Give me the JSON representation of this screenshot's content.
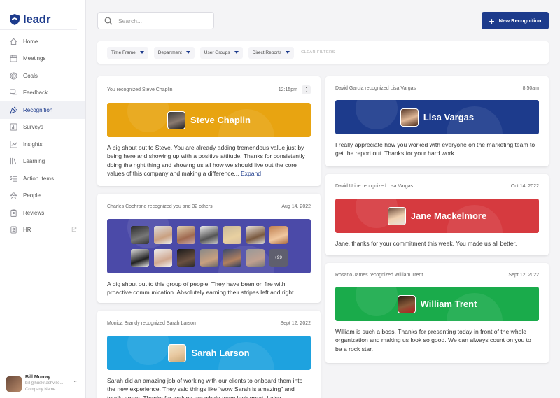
{
  "app": {
    "name": "leadr"
  },
  "sidebar": {
    "items": [
      {
        "label": "Home",
        "icon": "home-icon",
        "active": false
      },
      {
        "label": "Meetings",
        "icon": "meetings-icon",
        "active": false
      },
      {
        "label": "Goals",
        "icon": "target-icon",
        "active": false
      },
      {
        "label": "Feedback",
        "icon": "chat-bubbles-icon",
        "active": false
      },
      {
        "label": "Recognition",
        "icon": "party-popper-icon",
        "active": true
      },
      {
        "label": "Surveys",
        "icon": "bar-chart-icon",
        "active": false
      },
      {
        "label": "Insights",
        "icon": "trend-line-icon",
        "active": false
      },
      {
        "label": "Learning",
        "icon": "books-icon",
        "active": false
      },
      {
        "label": "Action Items",
        "icon": "checklist-icon",
        "active": false
      },
      {
        "label": "People",
        "icon": "people-icon",
        "active": false
      },
      {
        "label": "Reviews",
        "icon": "clipboard-icon",
        "active": false
      },
      {
        "label": "HR",
        "icon": "id-badge-icon",
        "active": false,
        "external": true
      }
    ],
    "user": {
      "name": "Bill Murray",
      "email": "bill@husknashville....",
      "company": "Company Name"
    }
  },
  "search": {
    "placeholder": "Search..."
  },
  "new_button": {
    "label": "New Recognition"
  },
  "filters": {
    "items": [
      "Time Frame",
      "Department",
      "User Groups",
      "Direct Reports"
    ],
    "clear": "CLEAR FILTERS"
  },
  "cards": [
    {
      "header": "You recognized Steve Chaplin",
      "time": "12:15pm",
      "recipient": "Steve Chaplin",
      "banner_color": "#e8a411",
      "text": "A big shout out to Steve. You are already adding tremendous value just by being here and showing up with a positive attitude. Thanks for consistently doing the right thing and showing us all how we should live out the core values of this company and making a difference...",
      "expand": "Expand"
    },
    {
      "header": "Charles Cochrane recognized you and 32 others",
      "time": "Aug 14, 2022",
      "banner_color": "#4b4aa8",
      "more_count": "+99",
      "text": "A big shout out to this group of people. They have been on fire with proactive communication. Absolutely earning their stripes left and right."
    },
    {
      "header": "Monica Brandy recognized Sarah Larson",
      "time": "Sept 12, 2022",
      "recipient": "Sarah Larson",
      "banner_color": "#1ea2df",
      "text": "Sarah did an amazing job of working with our clients to onboard them into the new experience. They said things like “wow Sarah is amazing” and I totally agree. Thanks for making our whole team look great. I also"
    },
    {
      "header": "David Garcia recognized Lisa Vargas",
      "time": "8:50am",
      "recipient": "Lisa Vargas",
      "banner_color": "#1d3b8c",
      "text": "I really appreciate how you worked with everyone on the marketing team to get the report out. Thanks for your hard work."
    },
    {
      "header": "David Uribe recognized Lisa Vargas",
      "time": "Oct 14, 2022",
      "recipient": "Jane Mackelmore",
      "banner_color": "#d63a3f",
      "text": "Jane, thanks for your commitment this week. You made us all better."
    },
    {
      "header": "Rosario James recognized William Trent",
      "time": "Sept 12, 2022",
      "recipient": "William Trent",
      "banner_color": "#1aab4b",
      "text": "William is such a boss. Thanks for presenting today in front of the whole organization and making us look so good. We can always count on you to be a rock star."
    }
  ]
}
